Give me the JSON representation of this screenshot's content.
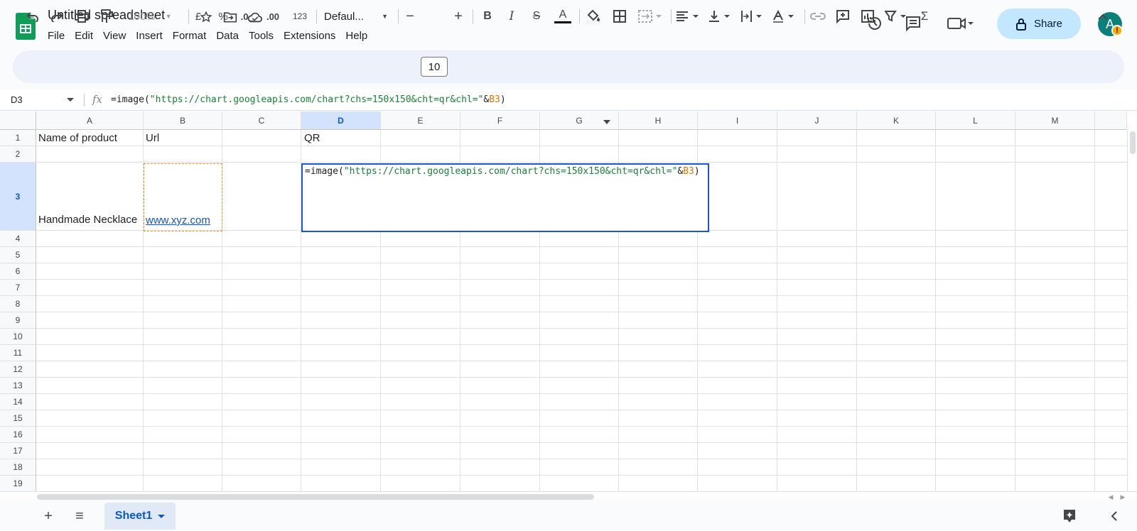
{
  "app": {
    "doc_title": "Untitled spreadsheet",
    "menus": [
      "File",
      "Edit",
      "View",
      "Insert",
      "Format",
      "Data",
      "Tools",
      "Extensions",
      "Help"
    ],
    "share_label": "Share",
    "avatar_letter": "A",
    "avatar_badge": "!",
    "brand_color": "#0f9d58",
    "share_bg": "#c2e7ff"
  },
  "toolbar": {
    "zoom": "100%",
    "currency": "£",
    "percent": "%",
    "dec_decrease": ".0",
    "dec_increase": ".00",
    "number_format": "123",
    "font": "Defaul...",
    "minus": "−",
    "font_size": "10",
    "plus": "+",
    "bold": "B",
    "italic": "I",
    "strike": "S",
    "text_color": "A",
    "sigma": "Σ"
  },
  "formula_bar": {
    "name_box": "D3",
    "fx": "fx",
    "prefix": "=image(",
    "string": "\"https://chart.googleapis.com/chart?chs=150x150&cht=qr&chl=\"",
    "amp": "&",
    "ref": "B3",
    "suffix": ")"
  },
  "grid": {
    "columns": [
      "A",
      "B",
      "C",
      "D",
      "E",
      "F",
      "G",
      "H",
      "I",
      "J",
      "K",
      "L",
      "M"
    ],
    "rows": [
      "1",
      "2",
      "3",
      "4",
      "5",
      "6",
      "7",
      "8",
      "9",
      "10",
      "11",
      "12",
      "13",
      "14",
      "15",
      "16",
      "17",
      "18",
      "19"
    ],
    "selected_col": "D",
    "selected_row": "3",
    "cells": {
      "A1": "Name of product",
      "B1": "Url",
      "D1": "QR",
      "A3": "Handmade Necklace",
      "B3": "www.xyz.com"
    }
  },
  "sheets": {
    "tabs": [
      "Sheet1"
    ],
    "add_label": "+",
    "list_label": "≡"
  }
}
